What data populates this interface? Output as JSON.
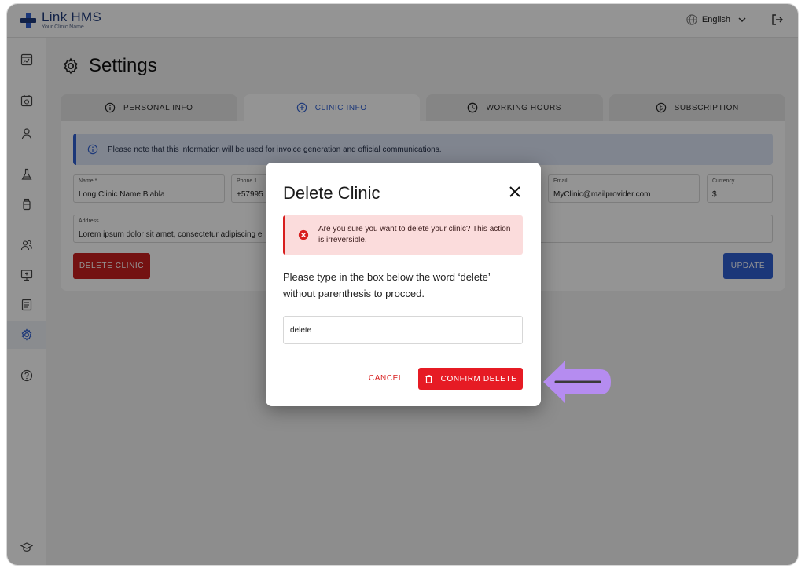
{
  "app": {
    "name": "Link HMS",
    "subtitle": "Your Clinic Name"
  },
  "header": {
    "language": "English"
  },
  "page": {
    "title": "Settings"
  },
  "tabs": [
    {
      "label": "PERSONAL INFO",
      "icon": "info-icon"
    },
    {
      "label": "CLINIC INFO",
      "icon": "plus-circle-icon",
      "active": true
    },
    {
      "label": "WORKING HOURS",
      "icon": "clock-icon"
    },
    {
      "label": "SUBSCRIPTION",
      "icon": "dollar-circle-icon"
    }
  ],
  "info_alert": "Please note that this information will be used for invoice generation and official communications.",
  "fields": {
    "name": {
      "label": "Name *",
      "value": "Long Clinic Name Blabla"
    },
    "phone": {
      "label": "Phone 1",
      "value": "+57995"
    },
    "email": {
      "label": "Email",
      "value": "MyClinic@mailprovider.com"
    },
    "currency": {
      "label": "Currency",
      "value": "$"
    },
    "address": {
      "label": "Address",
      "value": "Lorem ipsum dolor sit amet, consectetur adipiscing e"
    }
  },
  "buttons": {
    "delete_clinic": "DELETE CLINIC",
    "update": "UPDATE"
  },
  "modal": {
    "title": "Delete Clinic",
    "error": "Are you sure you want to delete your clinic? This action is irreversible.",
    "instructions": "Please type in the box below the word ‘delete’ without parenthesis to procced.",
    "input_value": "delete",
    "cancel": "CANCEL",
    "confirm": "CONFIRM DELETE"
  },
  "colors": {
    "primary": "#2f5fd1",
    "danger": "#e61b24",
    "brand": "#1e3a7a",
    "pointer": "#b58cf0"
  }
}
